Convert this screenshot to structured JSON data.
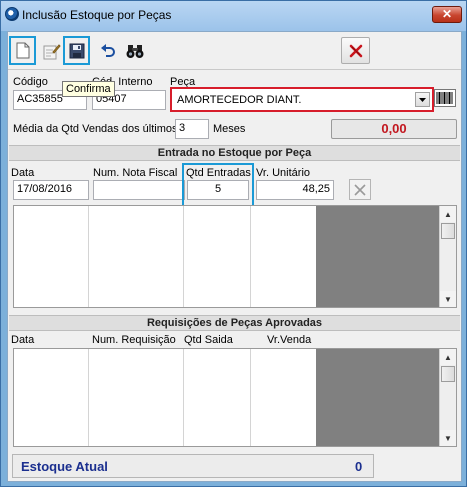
{
  "window": {
    "title": "Inclusão Estoque por Peças",
    "close_label": "✕"
  },
  "toolbar": {
    "tooltip": "Confirma",
    "buttons": [
      {
        "name": "new",
        "icon": "document-icon"
      },
      {
        "name": "edit",
        "icon": "edit-icon"
      },
      {
        "name": "save",
        "icon": "save-icon"
      },
      {
        "name": "undo",
        "icon": "undo-icon"
      },
      {
        "name": "search",
        "icon": "binoculars-icon"
      },
      {
        "name": "cancel",
        "icon": "red-x-icon"
      }
    ]
  },
  "header": {
    "codigo_label": "Código",
    "codigo_value": "AC35855",
    "cod_interno_label": "Cód. Interno",
    "cod_interno_value": "05407",
    "peca_label": "Peça",
    "peca_value": "AMORTECEDOR DIANT.",
    "media_label": "Média da Qtd Vendas dos últimos",
    "meses_value": "3",
    "meses_label": "Meses",
    "media_total": "0,00"
  },
  "entrada": {
    "title": "Entrada no Estoque por Peça",
    "data_label": "Data",
    "data_value": "17/08/2016",
    "nota_label": "Num. Nota Fiscal",
    "nota_value": "",
    "qtd_label": "Qtd Entradas",
    "qtd_value": "5",
    "valor_label": "Vr. Unitário",
    "valor_value": "48,25"
  },
  "requisicoes": {
    "title": "Requisições de Peças Aprovadas",
    "columns": [
      "Data",
      "Num. Requisição",
      "Qtd Saida",
      "Vr.Venda"
    ]
  },
  "footer": {
    "estoque_label": "Estoque Atual",
    "estoque_value": "0"
  },
  "colors": {
    "accent_blue": "#1b9ad6",
    "alert_red": "#d71d2b",
    "total_red": "#c2171f",
    "label_navy": "#1b2f8f"
  }
}
